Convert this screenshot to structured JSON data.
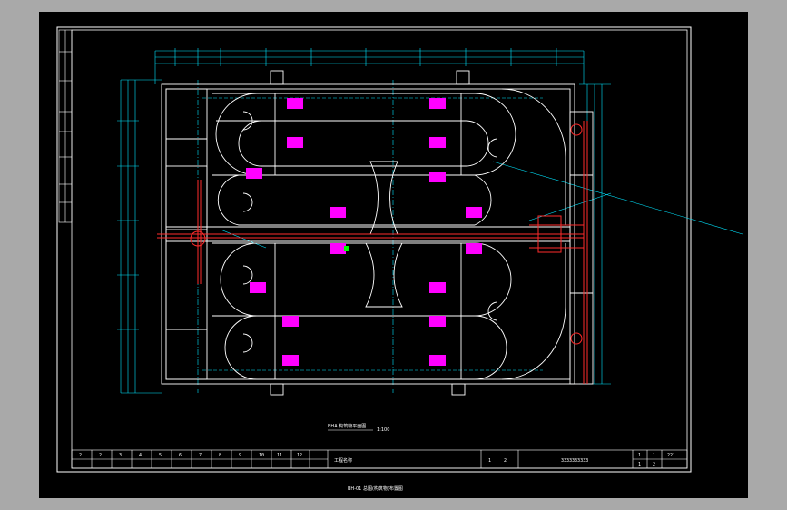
{
  "drawing": {
    "plan_title": "BHA 构筑物平面图",
    "plan_scale": "1:100",
    "bottom_caption": "BH-01 总图(构筑物)布置图"
  },
  "title_block": {
    "cells_left": [
      "2",
      "2",
      "3",
      "4",
      "5",
      "6",
      "7",
      "8",
      "9",
      "10",
      "11",
      "12"
    ],
    "project_name": "工程名称",
    "drawing_no": "3333333333",
    "sheet_left": "1",
    "sheet_right": "2",
    "rev_top": "1",
    "rev_top2": "1",
    "rev_bottom": "1",
    "rev_bottom2": "2",
    "corner_code": "221"
  },
  "colors": {
    "background": "#000000",
    "frame": "#ffffff",
    "dimension": "#00e5ff",
    "pipe": "#ff2b2b",
    "equipment": "#ff00ff",
    "marker": "#00ff00"
  }
}
